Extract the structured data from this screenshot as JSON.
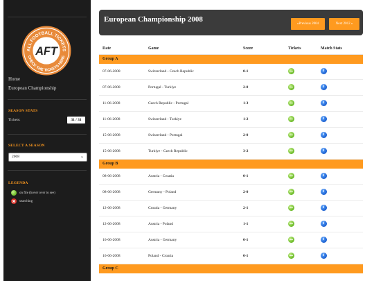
{
  "sidebar": {
    "logo": {
      "arc_top": "ALL FOOTBALL TICKETS",
      "center": "AFT",
      "arc_bottom": "CHECK THE TICKETS HERE"
    },
    "nav": [
      "Home",
      "European Championship"
    ],
    "season_stats": {
      "title": "SEASON STATS",
      "tickets_label": "Tickets:",
      "tickets_value": "31 / 31"
    },
    "select_season": {
      "title": "SELECT A SEASON",
      "selected": "2008"
    },
    "legenda": {
      "title": "LEGENDA",
      "items": [
        {
          "icon": "ticket-on-file-icon",
          "label": "on file (hover over to see)",
          "color": "#67b824"
        },
        {
          "icon": "searching-icon",
          "label": "searching",
          "color": "#d9342b"
        }
      ]
    }
  },
  "header": {
    "title": "European Championship 2008",
    "prev_label": "«Previous 2004",
    "next_label": "Next 2012 »",
    "accent": "#ff9a1f"
  },
  "table": {
    "columns": [
      "Date",
      "Game",
      "Score",
      "Tickets",
      "Match Stats"
    ],
    "groups": [
      {
        "name": "Group A",
        "matches": [
          {
            "date": "07-06-2008",
            "game": "Switzerland - Czech Republic",
            "score": "0-1"
          },
          {
            "date": "07-06-2008",
            "game": "Portugal - Turkiye",
            "score": "2-0"
          },
          {
            "date": "11-06-2008",
            "game": "Czech Republic - Portugal",
            "score": "1-3"
          },
          {
            "date": "11-06-2008",
            "game": "Switzerland - Turkiye",
            "score": "1-2"
          },
          {
            "date": "15-06-2008",
            "game": "Switzerland - Portugal",
            "score": "2-0"
          },
          {
            "date": "15-06-2008",
            "game": "Turkiye - Czech Republic",
            "score": "3-2"
          }
        ]
      },
      {
        "name": "Group B",
        "matches": [
          {
            "date": "08-06-2008",
            "game": "Austria - Croatia",
            "score": "0-1"
          },
          {
            "date": "08-06-2008",
            "game": "Germany - Poland",
            "score": "2-0"
          },
          {
            "date": "12-06-2008",
            "game": "Croatia - Germany",
            "score": "2-1"
          },
          {
            "date": "12-06-2008",
            "game": "Austria - Poland",
            "score": "1-1"
          },
          {
            "date": "16-06-2008",
            "game": "Austria - Germany",
            "score": "0-1"
          },
          {
            "date": "16-06-2008",
            "game": "Poland - Croatia",
            "score": "0-1"
          }
        ]
      },
      {
        "name": "Group C",
        "matches": []
      }
    ]
  }
}
